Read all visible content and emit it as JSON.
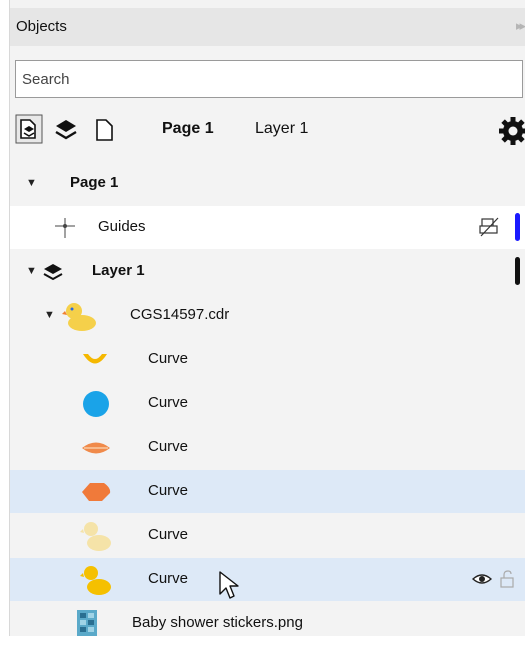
{
  "panel": {
    "title": "Objects",
    "collapse_icon": "double-chevron-right-icon"
  },
  "search": {
    "placeholder": "Search",
    "value": ""
  },
  "toolbar": {
    "page_label": "Page 1",
    "layer_label": "Layer 1",
    "icons": [
      "objects-view-icon",
      "layers-icon",
      "page-icon",
      "gear-icon"
    ]
  },
  "tree": {
    "page": {
      "label": "Page 1"
    },
    "guides": {
      "label": "Guides",
      "color": "#1a1aff"
    },
    "layer": {
      "label": "Layer 1",
      "color": "#111111"
    },
    "group": {
      "label": "CGS14597.cdr"
    },
    "curves": [
      {
        "label": "Curve",
        "icon": "arc-curve-icon",
        "color": "#f5b800"
      },
      {
        "label": "Curve",
        "icon": "circle-curve-icon",
        "color": "#1aa3e8"
      },
      {
        "label": "Curve",
        "icon": "beak-curve-icon",
        "color": "#f08040"
      },
      {
        "label": "Curve",
        "icon": "blob-curve-icon",
        "color": "#f07a3a"
      },
      {
        "label": "Curve",
        "icon": "duck-silhouette-light-icon",
        "color": "#f5e3a8"
      },
      {
        "label": "Curve",
        "icon": "duck-silhouette-icon",
        "color": "#f5c000"
      }
    ],
    "bitmap": {
      "label": "Baby shower stickers.png"
    }
  }
}
